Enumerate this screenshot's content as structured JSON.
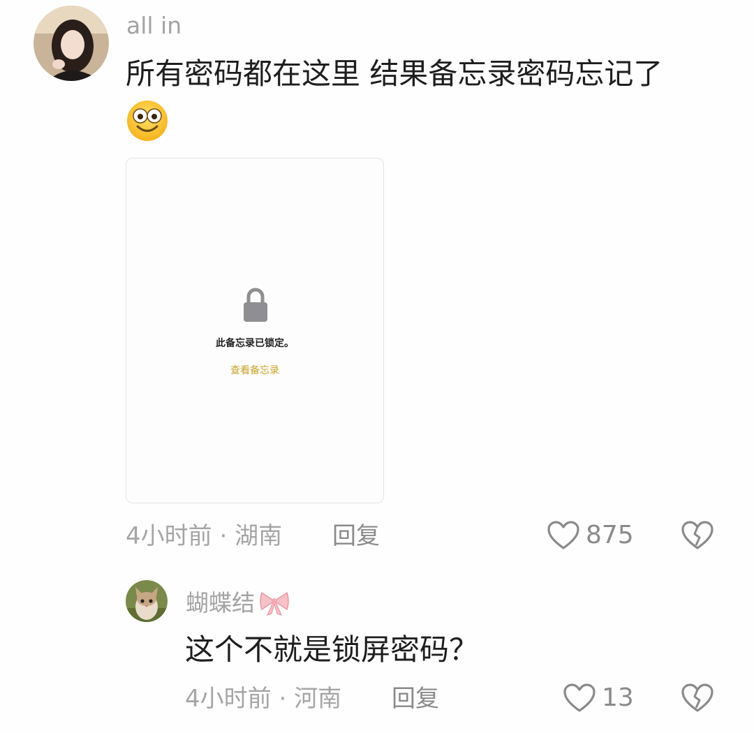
{
  "comments": [
    {
      "username": "all in",
      "text_line1": "所有密码都在这里 结果备忘录密码忘记了",
      "emoji": "smile-face-emoji",
      "image": {
        "locked_text": "此备忘录已锁定。",
        "view_link": "查看备忘录"
      },
      "time": "4小时前",
      "location": "湖南",
      "meta_separator": " · ",
      "reply_label": "回复",
      "likes": "875"
    },
    {
      "username": "蝴蝶结",
      "username_emoji": "bow-emoji",
      "text": "这个不就是锁屏密码？",
      "time": "4小时前",
      "location": "河南",
      "meta_separator": " · ",
      "reply_label": "回复",
      "likes": "13"
    }
  ],
  "colors": {
    "accent_link": "#c9a227",
    "muted_text": "#a5a5a5",
    "icon_gray": "#8a8a8a",
    "lock_gray": "#8e8e93"
  }
}
